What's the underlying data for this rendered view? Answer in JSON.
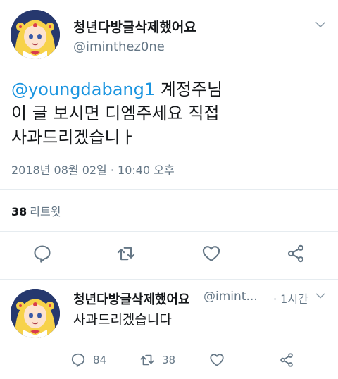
{
  "main_tweet": {
    "display_name": "청년다방글삭제했어요",
    "handle": "@iminthez0ne",
    "text": {
      "mention": "@youngdabang1",
      "line1_rest": " 계정주님",
      "line2": "이 글 보시면 디엠주세요 직접",
      "line3": "사과드리겠습니ㅏ"
    },
    "timestamp": "2018년 08월 02일 · 10:40 오후",
    "retweets": {
      "count": "38",
      "label": "리트윗"
    }
  },
  "reply_tweet": {
    "display_name": "청년다방글삭제했어요",
    "handle": "@imint...",
    "time": "· 1시간",
    "text": "사과드리겠습니다",
    "reply_count": "84",
    "retweet_count": "38"
  },
  "colors": {
    "accent": "#1b95e0",
    "secondary_text": "#657786",
    "icon": "#657786",
    "divider": "#e6ecf0"
  },
  "icons": [
    "chevron-down-icon",
    "reply-icon",
    "retweet-icon",
    "like-icon",
    "share-icon"
  ]
}
